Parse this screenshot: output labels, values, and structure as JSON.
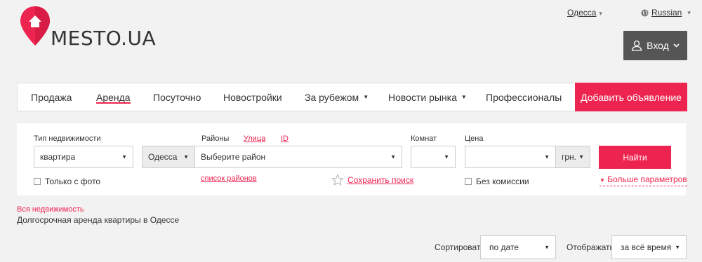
{
  "brand": {
    "name": "MESTO.UA",
    "color": "#ee2450"
  },
  "header": {
    "city": "Одесса",
    "language": "Russian",
    "login_label": "Вход"
  },
  "nav": {
    "items": [
      {
        "label": "Продажа"
      },
      {
        "label": "Аренда",
        "active": true
      },
      {
        "label": "Посуточно"
      },
      {
        "label": "Новостройки"
      },
      {
        "label": "За рубежом",
        "dropdown": true
      },
      {
        "label": "Новости рынка",
        "dropdown": true
      },
      {
        "label": "Профессионалы"
      }
    ],
    "add_listing_label": "Добавить объявление"
  },
  "filters": {
    "property_type": {
      "label": "Тип недвижимости",
      "value": "квартира"
    },
    "location": {
      "label": "Районы",
      "street_link": "Улица",
      "id_link": "ID",
      "city_value": "Одесса",
      "district_placeholder": "Выберите район",
      "district_list_link": "список районов"
    },
    "rooms": {
      "label": "Комнат",
      "value": ""
    },
    "price": {
      "label": "Цена",
      "value": "",
      "currency": "грн."
    },
    "search_button": "Найти",
    "only_photo": "Только с фото",
    "no_commission": "Без комиссии",
    "save_search": "Сохранить поиск",
    "more_params": "Больше параметров"
  },
  "breadcrumb": "Вся недвижимость",
  "page_title": "Долгосрочная аренда квартиры в Одессе",
  "sort": {
    "label": "Сортировать",
    "value": "по дате"
  },
  "show": {
    "label": "Отображать",
    "value": "за всё время"
  }
}
